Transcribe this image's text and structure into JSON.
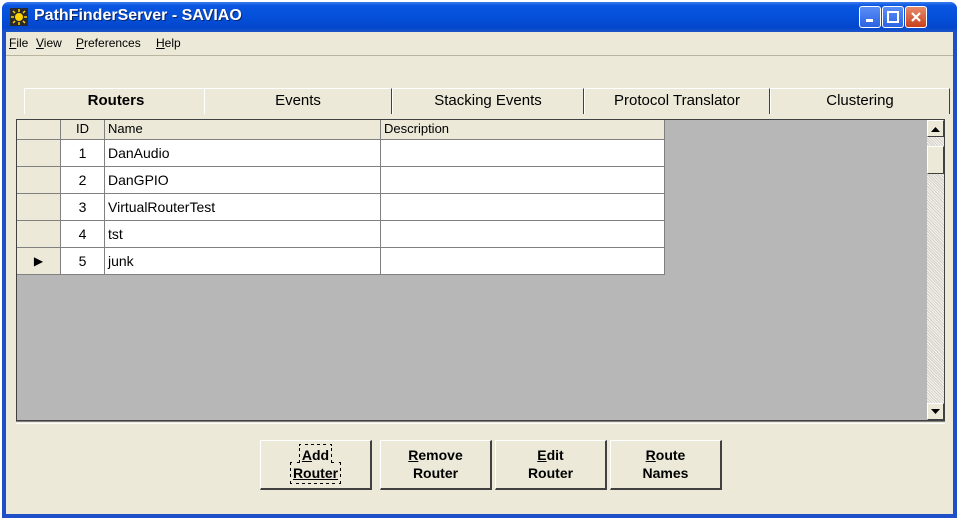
{
  "window": {
    "title": "PathFinderServer - SAVIAO"
  },
  "menu": {
    "items": [
      {
        "ul": "F",
        "rest": "ile"
      },
      {
        "ul": "V",
        "rest": "iew"
      },
      {
        "ul": "P",
        "rest": "references"
      },
      {
        "ul": "H",
        "rest": "elp"
      }
    ]
  },
  "tabs": [
    "Routers",
    "Events",
    "Stacking Events",
    "Protocol Translator",
    "Clustering"
  ],
  "active_tab": "Routers",
  "table": {
    "columns": [
      "ID",
      "Name",
      "Description"
    ],
    "rows": [
      {
        "id": "1",
        "name": "DanAudio",
        "description": ""
      },
      {
        "id": "2",
        "name": "DanGPIO",
        "description": ""
      },
      {
        "id": "3",
        "name": "VirtualRouterTest",
        "description": ""
      },
      {
        "id": "4",
        "name": "tst",
        "description": ""
      },
      {
        "id": "5",
        "name": "junk",
        "description": ""
      }
    ],
    "current_row_marker": "▶"
  },
  "buttons": [
    {
      "ul": "A",
      "line1_rest": "dd",
      "line2": "Router"
    },
    {
      "ul": "R",
      "line1_rest": "emove",
      "line2": "Router"
    },
    {
      "ul": "E",
      "line1_rest": "dit",
      "line2": "Router"
    },
    {
      "ul": "R",
      "line1_rest": "oute",
      "line2": "Names"
    }
  ],
  "colors": {
    "titlebar": "#0550da",
    "close": "#c8401c",
    "face": "#ece9d8"
  }
}
